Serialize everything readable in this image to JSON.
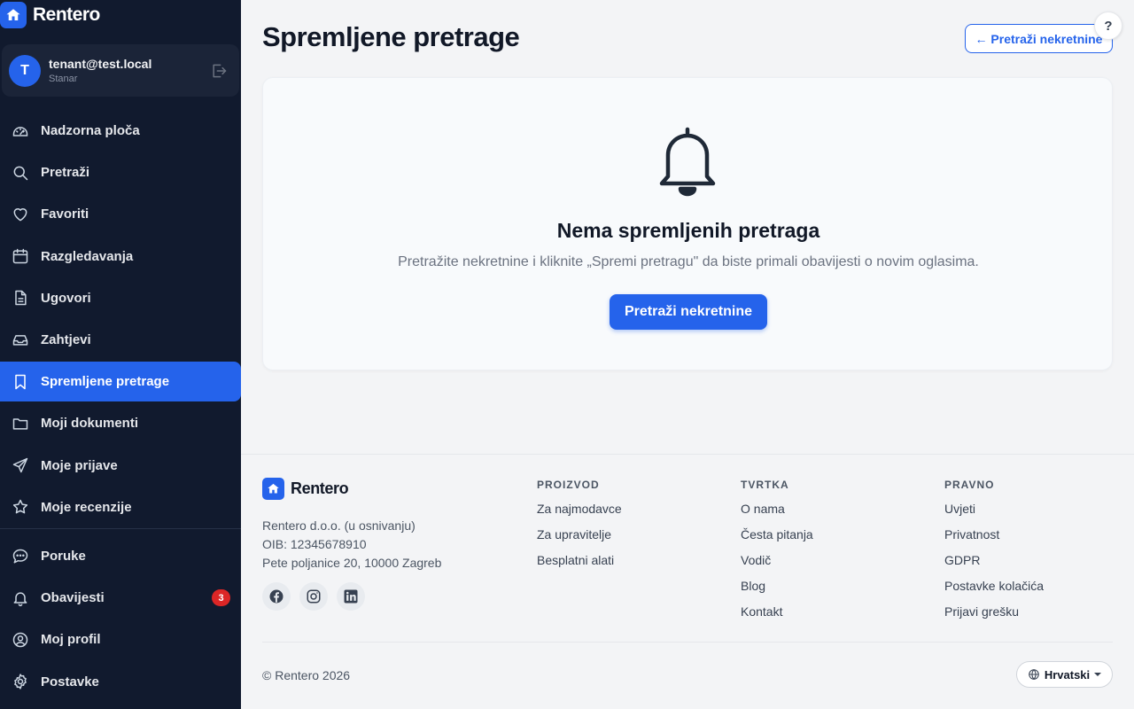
{
  "app": {
    "name": "Rentero",
    "accent": "#2563eb",
    "sidebar_bg": "#111a2e",
    "badge_color": "#dc2626"
  },
  "user": {
    "initial": "T",
    "email": "tenant@test.local",
    "role": "Stanar"
  },
  "sidebar": {
    "items": [
      {
        "label": "Nadzorna ploča",
        "icon": "dashboard-icon"
      },
      {
        "label": "Pretraži",
        "icon": "search-icon"
      },
      {
        "label": "Favoriti",
        "icon": "heart-icon"
      },
      {
        "label": "Razgledavanja",
        "icon": "calendar-icon"
      },
      {
        "label": "Ugovori",
        "icon": "document-icon"
      },
      {
        "label": "Zahtjevi",
        "icon": "inbox-icon"
      },
      {
        "label": "Spremljene pretrage",
        "icon": "bookmark-icon",
        "active": true
      },
      {
        "label": "Moji dokumenti",
        "icon": "folder-icon"
      },
      {
        "label": "Moje prijave",
        "icon": "send-icon"
      },
      {
        "label": "Moje recenzije",
        "icon": "star-icon"
      }
    ],
    "secondary": [
      {
        "label": "Poruke",
        "icon": "chat-icon"
      },
      {
        "label": "Obavijesti",
        "icon": "bell-icon",
        "badge": "3"
      },
      {
        "label": "Moj profil",
        "icon": "user-circle-icon"
      },
      {
        "label": "Postavke",
        "icon": "gear-icon"
      }
    ]
  },
  "main": {
    "title": "Spremljene pretrage",
    "back_button": "← Pretraži nekretnine",
    "help": "?",
    "empty": {
      "icon": "bell-icon",
      "title": "Nema spremljenih pretraga",
      "subtitle": "Pretražite nekretnine i kliknite „Spremi pretragu\" da biste primali obavijesti o novim oglasima.",
      "button": "Pretraži nekretnine"
    }
  },
  "footer": {
    "brand": "Rentero",
    "company_lines": [
      "Rentero d.o.o. (u osnivanju)",
      "OIB: 12345678910",
      "Pete poljanice 20, 10000 Zagreb"
    ],
    "socials": [
      "facebook-icon",
      "instagram-icon",
      "linkedin-icon"
    ],
    "columns": [
      {
        "heading": "PROIZVOD",
        "links": [
          "Za najmodavce",
          "Za upravitelje",
          "Besplatni alati"
        ]
      },
      {
        "heading": "TVRTKA",
        "links": [
          "O nama",
          "Česta pitanja",
          "Vodič",
          "Blog",
          "Kontakt"
        ]
      },
      {
        "heading": "PRAVNO",
        "links": [
          "Uvjeti",
          "Privatnost",
          "GDPR",
          "Postavke kolačića",
          "Prijavi grešku"
        ]
      }
    ],
    "copyright": "© Rentero 2026",
    "language": "Hrvatski"
  }
}
